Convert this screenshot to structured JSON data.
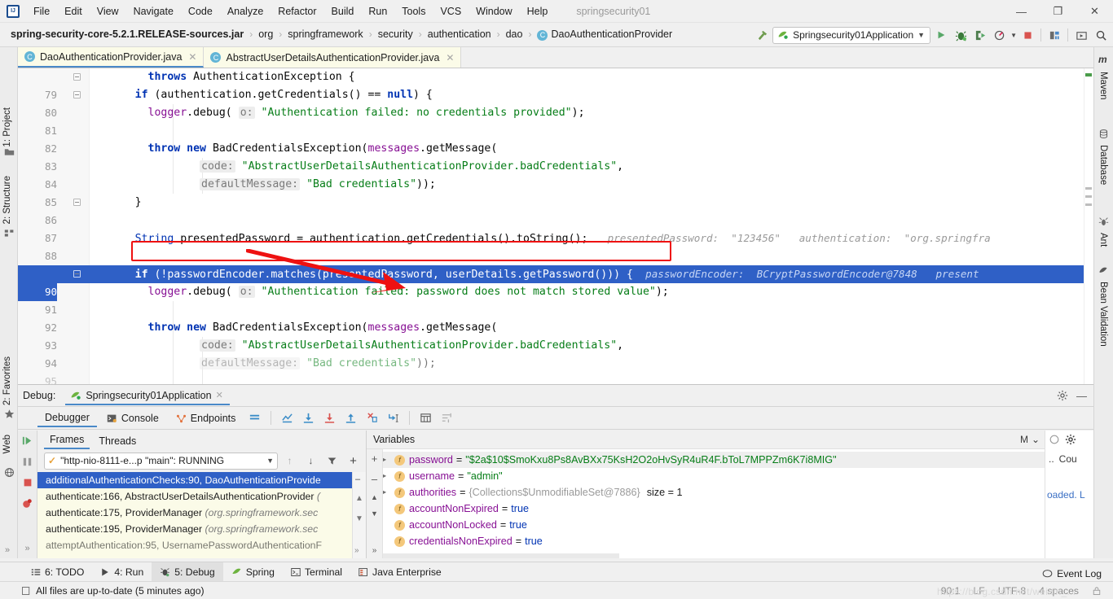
{
  "window": {
    "title": "springsecurity01",
    "controls": {
      "minimize": "—",
      "maximize": "❐",
      "close": "✕"
    }
  },
  "menu": [
    {
      "label": "File"
    },
    {
      "label": "Edit"
    },
    {
      "label": "View"
    },
    {
      "label": "Navigate"
    },
    {
      "label": "Code"
    },
    {
      "label": "Analyze"
    },
    {
      "label": "Refactor"
    },
    {
      "label": "Build"
    },
    {
      "label": "Run"
    },
    {
      "label": "Tools"
    },
    {
      "label": "VCS"
    },
    {
      "label": "Window"
    },
    {
      "label": "Help"
    }
  ],
  "breadcrumb": {
    "items": [
      {
        "label": "spring-security-core-5.2.1.RELEASE-sources.jar",
        "bold": true
      },
      {
        "label": "org"
      },
      {
        "label": "springframework"
      },
      {
        "label": "security"
      },
      {
        "label": "authentication"
      },
      {
        "label": "dao"
      },
      {
        "label": "DaoAuthenticationProvider",
        "icon": "class-icon"
      }
    ],
    "separator": "›"
  },
  "toolbar": {
    "run_config": "Springsecurity01Application",
    "buttons": [
      {
        "name": "run-button",
        "glyph": "▶"
      },
      {
        "name": "debug-button",
        "glyph": "🐞"
      },
      {
        "name": "run-coverage-button",
        "glyph": "▣"
      },
      {
        "name": "profiler-button",
        "glyph": "◔"
      },
      {
        "name": "stop-button",
        "glyph": "■"
      },
      {
        "name": "project-structure-button",
        "glyph": "▤"
      },
      {
        "name": "select-in-button",
        "glyph": "▭"
      },
      {
        "name": "search-everywhere-button",
        "glyph": "🔍"
      }
    ]
  },
  "left_stripe": [
    {
      "label": "1: Project",
      "icon": "folder-icon"
    },
    {
      "label": "2: Structure",
      "icon": "structure-icon"
    }
  ],
  "left_stripe_bottom": [
    {
      "label": "2: Favorites",
      "icon": "star-icon"
    },
    {
      "label": "Web",
      "icon": "globe-icon"
    }
  ],
  "right_stripe": [
    {
      "label": "Maven",
      "icon": "maven-icon"
    },
    {
      "label": "Database",
      "icon": "database-icon"
    },
    {
      "label": "Ant",
      "icon": "ant-icon"
    },
    {
      "label": "Bean Validation",
      "icon": "bean-icon"
    }
  ],
  "editor_tabs": [
    {
      "label": "DaoAuthenticationProvider.java",
      "active": true,
      "close": "✕"
    },
    {
      "label": "AbstractUserDetailsAuthenticationProvider.java",
      "active": false,
      "close": "✕"
    }
  ],
  "code": {
    "lines": [
      {
        "num": "79",
        "indent": 8,
        "fold": true,
        "tokens": [
          {
            "t": "kw",
            "v": "throws"
          },
          {
            "t": "pln",
            "v": " AuthenticationException {"
          }
        ]
      },
      {
        "num": "80",
        "indent": 6,
        "fold": true,
        "tokens": [
          {
            "t": "kw",
            "v": "if"
          },
          {
            "t": "pln",
            "v": " (authentication.getCredentials() == "
          },
          {
            "t": "kw",
            "v": "null"
          },
          {
            "t": "pln",
            "v": ") {"
          }
        ]
      },
      {
        "num": "81",
        "indent": 8,
        "tokens": [
          {
            "t": "fld",
            "v": "logger"
          },
          {
            "t": "pln",
            "v": ".debug( "
          },
          {
            "t": "param",
            "v": "o:"
          },
          {
            "t": "str",
            "v": " \"Authentication failed: no credentials provided\""
          },
          {
            "t": "pln",
            "v": ");"
          }
        ]
      },
      {
        "num": "82",
        "indent": 0,
        "tokens": []
      },
      {
        "num": "83",
        "indent": 8,
        "tokens": [
          {
            "t": "kw",
            "v": "throw"
          },
          {
            "t": "pln",
            "v": " "
          },
          {
            "t": "kw",
            "v": "new"
          },
          {
            "t": "pln",
            "v": " BadCredentialsException("
          },
          {
            "t": "fld",
            "v": "messages"
          },
          {
            "t": "pln",
            "v": ".getMessage("
          }
        ]
      },
      {
        "num": "84",
        "indent": 16,
        "tokens": [
          {
            "t": "param",
            "v": "code:"
          },
          {
            "t": "str",
            "v": " \"AbstractUserDetailsAuthenticationProvider.badCredentials\""
          },
          {
            "t": "pln",
            "v": ","
          }
        ]
      },
      {
        "num": "85",
        "indent": 16,
        "tokens": [
          {
            "t": "param",
            "v": "defaultMessage:"
          },
          {
            "t": "str",
            "v": " \"Bad credentials\""
          },
          {
            "t": "pln",
            "v": "));"
          }
        ]
      },
      {
        "num": "86",
        "indent": 6,
        "fold": true,
        "tokens": [
          {
            "t": "pln",
            "v": "}"
          }
        ]
      },
      {
        "num": "87",
        "indent": 0,
        "tokens": []
      },
      {
        "num": "88",
        "indent": 6,
        "boxed": true,
        "tokens": [
          {
            "t": "kw2",
            "v": "String"
          },
          {
            "t": "pln",
            "v": " presentedPassword = authentication.getCredentials().toString();"
          }
        ],
        "hint": "presentedPassword:  \"123456\"   authentication:  \"org.springfra"
      },
      {
        "num": "89",
        "indent": 0,
        "tokens": []
      },
      {
        "num": "90",
        "indent": 6,
        "selected": true,
        "current": true,
        "tokens": [
          {
            "t": "kw",
            "v": "if"
          },
          {
            "t": "pln",
            "v": " (!passwordEncoder.matches(presentedPassword, userDetails.getPassword())) {"
          }
        ],
        "hint": "passwordEncoder:  BCryptPasswordEncoder@7848   present"
      },
      {
        "num": "91",
        "indent": 8,
        "tokens": [
          {
            "t": "fld",
            "v": "logger"
          },
          {
            "t": "pln",
            "v": ".debug( "
          },
          {
            "t": "param",
            "v": "o:"
          },
          {
            "t": "str",
            "v": " \"Authentication failed: password does not match stored value\""
          },
          {
            "t": "pln",
            "v": ");"
          }
        ]
      },
      {
        "num": "92",
        "indent": 0,
        "tokens": []
      },
      {
        "num": "93",
        "indent": 8,
        "tokens": [
          {
            "t": "kw",
            "v": "throw"
          },
          {
            "t": "pln",
            "v": " "
          },
          {
            "t": "kw",
            "v": "new"
          },
          {
            "t": "pln",
            "v": " BadCredentialsException("
          },
          {
            "t": "fld",
            "v": "messages"
          },
          {
            "t": "pln",
            "v": ".getMessage("
          }
        ]
      },
      {
        "num": "94",
        "indent": 16,
        "tokens": [
          {
            "t": "param",
            "v": "code:"
          },
          {
            "t": "str",
            "v": " \"AbstractUserDetailsAuthenticationProvider.badCredentials\""
          },
          {
            "t": "pln",
            "v": ","
          }
        ]
      },
      {
        "num": "95",
        "indent": 16,
        "tokens": [
          {
            "t": "param",
            "v": "defaultMessage:"
          },
          {
            "t": "str",
            "v": " \"Bad credentials\""
          },
          {
            "t": "pln",
            "v": "));"
          }
        ]
      }
    ]
  },
  "debug": {
    "label": "Debug:",
    "session_tab": "Springsecurity01Application",
    "session_close": "✕",
    "tabs": [
      {
        "label": "Debugger",
        "active": true,
        "icon": ""
      },
      {
        "label": "Console",
        "active": false,
        "icon": "console-icon"
      },
      {
        "label": "Endpoints",
        "active": false,
        "icon": "endpoints-icon"
      }
    ],
    "toolbar_buttons": [
      {
        "name": "layout-button",
        "glyph": "≡"
      },
      {
        "name": "show-execution-point-button",
        "glyph": "⌁"
      },
      {
        "name": "step-over-button",
        "glyph": "⤓"
      },
      {
        "name": "step-into-button",
        "glyph": "⤓"
      },
      {
        "name": "step-out-button",
        "glyph": "⤒"
      },
      {
        "name": "force-step-into-button",
        "glyph": "✶"
      },
      {
        "name": "run-to-cursor-button",
        "glyph": "⌖"
      },
      {
        "name": "evaluate-expression-button",
        "glyph": "▦"
      },
      {
        "name": "settings-button",
        "glyph": "≋"
      }
    ],
    "frames": {
      "tabs": [
        {
          "label": "Frames",
          "active": true
        },
        {
          "label": "Threads",
          "active": false
        }
      ],
      "thread_selector": "\"http-nio-8111-e...p \"main\": RUNNING",
      "thread_status_icon": "check-icon",
      "rows": [
        {
          "method": "additionalAuthenticationChecks:90, DaoAuthenticationProvide",
          "pkg": "",
          "selected": true
        },
        {
          "method": "authenticate:166, AbstractUserDetailsAuthenticationProvider ",
          "pkg": "(",
          "selected": false
        },
        {
          "method": "authenticate:175, ProviderManager ",
          "pkg": "(org.springframework.sec",
          "selected": false
        },
        {
          "method": "authenticate:195, ProviderManager ",
          "pkg": "(org.springframework.sec",
          "selected": false
        },
        {
          "method": "attemptAuthentication:95, UsernamePasswordAuthenticationF",
          "pkg": "",
          "selected": false
        }
      ]
    },
    "variables": {
      "title": "Variables",
      "rows": [
        {
          "expandable": true,
          "name": "password",
          "eq": "=",
          "value": "\"$2a$10$SmoKxu8Ps8AvBXx75KsH2O2oHvSyR4uR4F.bToL7MPPZm6K7i8MIG\"",
          "kind": "string",
          "highlight": true
        },
        {
          "expandable": true,
          "name": "username",
          "eq": "=",
          "value": "\"admin\"",
          "kind": "string"
        },
        {
          "expandable": true,
          "name": "authorities",
          "eq": "=",
          "value": "{Collections$UnmodifiableSet@7886}",
          "kind": "ref",
          "extra": "size = 1"
        },
        {
          "expandable": false,
          "name": "accountNonExpired",
          "eq": "=",
          "value": "true",
          "kind": "bool"
        },
        {
          "expandable": false,
          "name": "accountNonLocked",
          "eq": "=",
          "value": "true",
          "kind": "bool"
        },
        {
          "expandable": false,
          "name": "credentialsNonExpired",
          "eq": "=",
          "value": "true",
          "kind": "bool"
        }
      ],
      "right_panel": {
        "tab": "M",
        "chevron": "⌄",
        "label1": "..",
        "label2": "Cou",
        "text": "oaded. L"
      }
    }
  },
  "tool_windows": [
    {
      "label": "6: TODO",
      "icon": "todo-icon",
      "active": false
    },
    {
      "label": "4: Run",
      "icon": "run-icon",
      "active": false
    },
    {
      "label": "5: Debug",
      "icon": "debug-icon",
      "active": true
    },
    {
      "label": "Spring",
      "icon": "spring-icon",
      "active": false
    },
    {
      "label": "Terminal",
      "icon": "terminal-icon",
      "active": false
    },
    {
      "label": "Java Enterprise",
      "icon": "javaee-icon",
      "active": false
    }
  ],
  "status": {
    "message": "All files are up-to-date (5 minutes ago)",
    "event_log": "Event Log",
    "caret": "90:1",
    "line_sep": "LF",
    "encoding": "UTF-8",
    "indent": "4 spaces",
    "lock_icon": "lock-icon"
  },
  "colors": {
    "accent_blue": "#2f60c6",
    "tab_underline": "#4a89c8",
    "annotation_red": "#ee1111",
    "string_green": "#067d17",
    "keyword_blue": "#0033b3",
    "field_purple": "#871094",
    "tab_yellow": "#fbfbe8"
  }
}
